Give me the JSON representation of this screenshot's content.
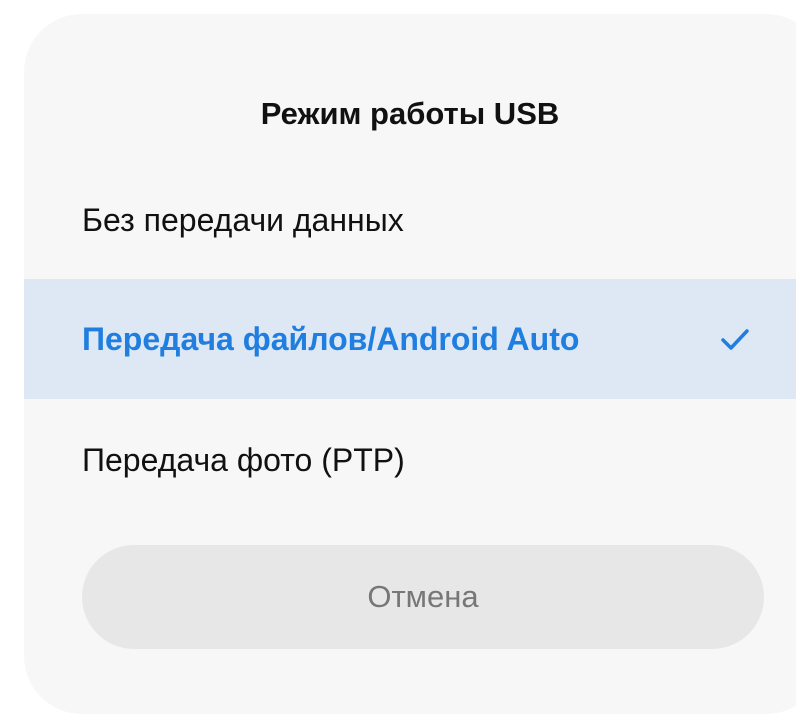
{
  "dialog": {
    "title": "Режим работы USB",
    "options": [
      {
        "label": "Без передачи данных",
        "selected": false
      },
      {
        "label": "Передача файлов/Android Auto",
        "selected": true
      },
      {
        "label": "Передача фото (PTP)",
        "selected": false
      }
    ],
    "cancel_label": "Отмена"
  },
  "colors": {
    "accent": "#1f7ee0",
    "selected_background": "#dde8f4",
    "dialog_background": "#f7f7f7",
    "button_background": "#e7e7e7"
  },
  "icons": {
    "selected_indicator": "checkmark-icon"
  }
}
